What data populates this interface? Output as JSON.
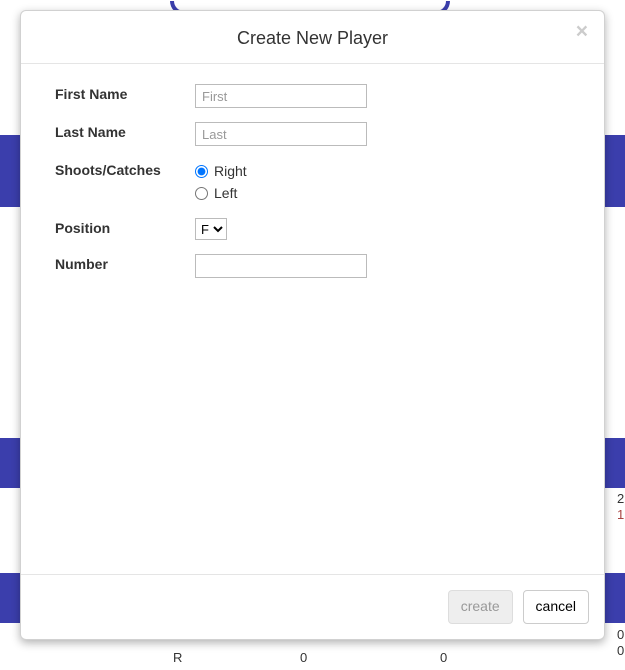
{
  "modal": {
    "title": "Create New Player",
    "close_label": "×",
    "fields": {
      "first_name": {
        "label": "First Name",
        "placeholder": "First",
        "value": ""
      },
      "last_name": {
        "label": "Last Name",
        "placeholder": "Last",
        "value": ""
      },
      "hand": {
        "label": "Shoots/Catches",
        "option_right": "Right",
        "option_left": "Left",
        "selected": "Right"
      },
      "position": {
        "label": "Position",
        "selected": "F"
      },
      "number": {
        "label": "Number",
        "value": ""
      }
    },
    "buttons": {
      "create": "create",
      "cancel": "cancel"
    }
  },
  "background": {
    "col_r": "R",
    "col_0a": "0",
    "col_0b": "0",
    "stat_2": "2",
    "stat_1": "1",
    "stat_0a": "0",
    "stat_0b": "0"
  }
}
